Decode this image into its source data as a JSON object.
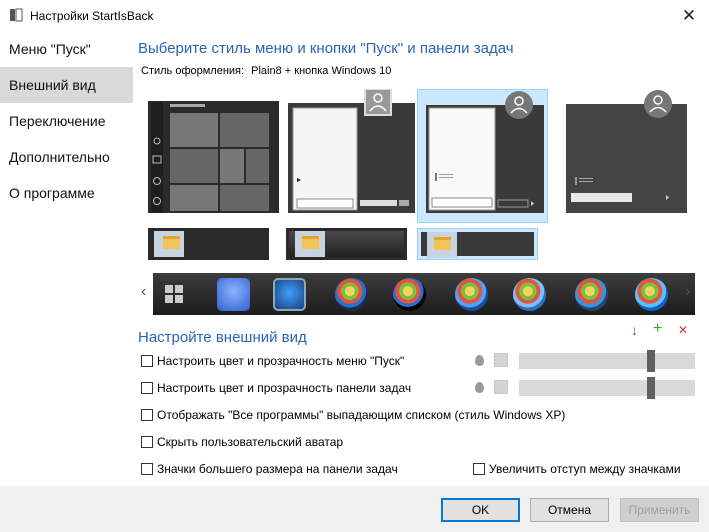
{
  "window": {
    "title": "Настройки StartIsBack",
    "close_glyph": "✕"
  },
  "sidebar": {
    "items": [
      {
        "label": "Меню \"Пуск\""
      },
      {
        "label": "Внешний вид"
      },
      {
        "label": "Переключение"
      },
      {
        "label": "Дополнительно"
      },
      {
        "label": "О программе"
      }
    ],
    "active_index": 1
  },
  "main": {
    "heading": "Выберите стиль меню и кнопки \"Пуск\" и панели задач",
    "style_label": "Стиль оформления:",
    "style_value": "Plain8 + кнопка Windows 10",
    "selected_thumbnail_index": 2,
    "nav_left": "‹",
    "nav_right": "›"
  },
  "appearance": {
    "heading": "Настройте внешний вид",
    "tools": {
      "download": "↓",
      "add": "+",
      "remove": "✕"
    },
    "options": [
      {
        "label": "Настроить цвет и прозрачность меню \"Пуск\"",
        "checked": false,
        "slider_value": 0.75
      },
      {
        "label": "Настроить цвет и прозрачность панели задач",
        "checked": false,
        "slider_value": 0.75
      },
      {
        "label": "Отображать \"Все программы\" выпадающим списком (стиль Windows XP)",
        "checked": false
      },
      {
        "label": "Скрыть пользовательский аватар",
        "checked": false
      },
      {
        "label": "Значки большего размера на панели задач",
        "checked": false
      },
      {
        "label": "Увеличить отступ между значками",
        "checked": false
      }
    ]
  },
  "footer": {
    "ok": "OK",
    "cancel": "Отмена",
    "apply": "Применить"
  },
  "colors": {
    "accent": "#2c63b4",
    "selection": "#cce8ff",
    "sidebar_active": "#d9d9d9"
  }
}
